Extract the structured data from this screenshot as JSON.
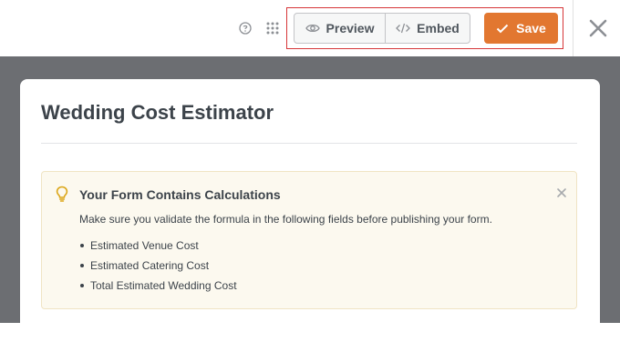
{
  "toolbar": {
    "preview_label": "Preview",
    "embed_label": "Embed",
    "save_label": "Save",
    "icons": [
      "help-icon",
      "grid-icon",
      "eye-icon",
      "code-icon",
      "checkmark-icon",
      "close-icon"
    ],
    "colors": {
      "save": "#e27730",
      "highlight": "#d63638"
    }
  },
  "form": {
    "title": "Wedding Cost Estimator"
  },
  "notice": {
    "title": "Your Form Contains Calculations",
    "message": "Make sure you validate the formula in the following fields before publishing your form.",
    "fields": [
      "Estimated Venue Cost",
      "Estimated Catering Cost",
      "Total Estimated Wedding Cost"
    ],
    "colors": {
      "background": "#fcf9ef",
      "icon": "#dba617"
    }
  }
}
